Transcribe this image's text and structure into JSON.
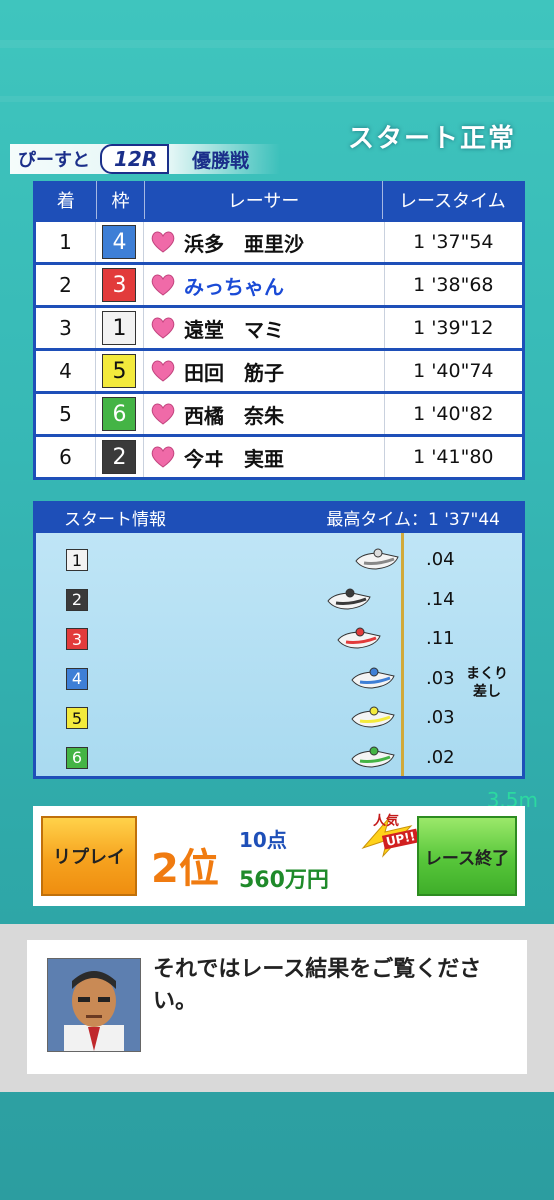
{
  "header": {
    "status": "スタート正常",
    "race_name": "ぴーすと",
    "race_number": "12R",
    "race_title": "優勝戦"
  },
  "results": {
    "columns": [
      "着",
      "枠",
      "レーサー",
      "レースタイム"
    ],
    "rows": [
      {
        "rank": "1",
        "frame": "4",
        "name": "浜多　亜里沙",
        "time": "1 '37\"54",
        "highlight": false
      },
      {
        "rank": "2",
        "frame": "3",
        "name": "みっちゃん",
        "time": "1 '38\"68",
        "highlight": true
      },
      {
        "rank": "3",
        "frame": "1",
        "name": "遠堂　マミ",
        "time": "1 '39\"12",
        "highlight": false
      },
      {
        "rank": "4",
        "frame": "5",
        "name": "田回　筋子",
        "time": "1 '40\"74",
        "highlight": false
      },
      {
        "rank": "5",
        "frame": "6",
        "name": "西橘　奈朱",
        "time": "1 '40\"82",
        "highlight": false
      },
      {
        "rank": "6",
        "frame": "2",
        "name": "今ヰ　実亜",
        "time": "1 '41\"80",
        "highlight": false
      }
    ]
  },
  "start_info": {
    "title": "スタート情報",
    "best_time": "最高タイム：1 '37\"44",
    "rows": [
      {
        "frame": "1",
        "st": ".04"
      },
      {
        "frame": "2",
        "st": ".14"
      },
      {
        "frame": "3",
        "st": ".11"
      },
      {
        "frame": "4",
        "st": ".03"
      },
      {
        "frame": "5",
        "st": ".03"
      },
      {
        "frame": "6",
        "st": ".02"
      }
    ],
    "note_line1": "まくり",
    "note_line2": "差し"
  },
  "distance": "3.5m",
  "result_bar": {
    "replay_label": "リプレイ",
    "place": "2位",
    "points": "10点",
    "prize": "560万円",
    "popular_label": "人気",
    "popular_up": "UP!!",
    "end_label": "レース終了"
  },
  "message": {
    "text": "それではレース結果をご覧ください。"
  },
  "frame_colors": {
    "1": {
      "bg": "#f2f2f2",
      "fg": "#111"
    },
    "2": {
      "bg": "#3a3a3a",
      "fg": "#fff"
    },
    "3": {
      "bg": "#e23b3b",
      "fg": "#fff"
    },
    "4": {
      "bg": "#3e7fd6",
      "fg": "#fff"
    },
    "5": {
      "bg": "#f3ea3c",
      "fg": "#111"
    },
    "6": {
      "bg": "#44b445",
      "fg": "#fff"
    }
  },
  "highlight_color": "#1b4bd6",
  "heart_color": "#f06aa8"
}
